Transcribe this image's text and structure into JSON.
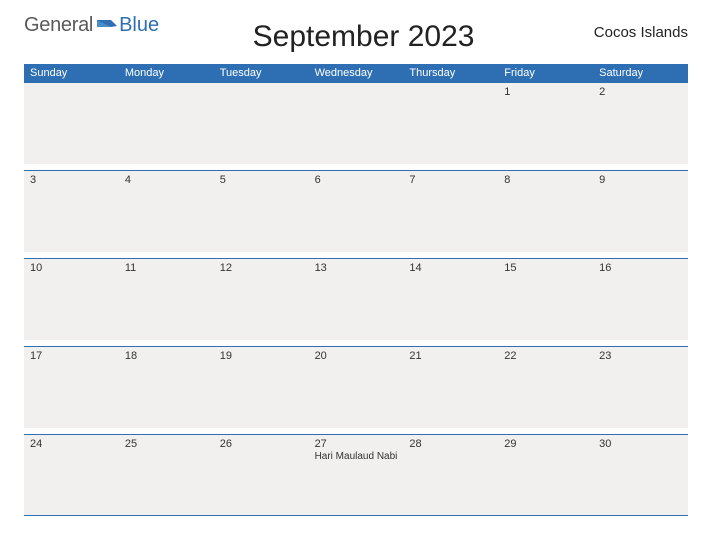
{
  "logo": {
    "general": "General",
    "blue": "Blue"
  },
  "title": "September 2023",
  "region": "Cocos Islands",
  "days": [
    "Sunday",
    "Monday",
    "Tuesday",
    "Wednesday",
    "Thursday",
    "Friday",
    "Saturday"
  ],
  "weeks": [
    [
      {
        "num": ""
      },
      {
        "num": ""
      },
      {
        "num": ""
      },
      {
        "num": ""
      },
      {
        "num": ""
      },
      {
        "num": "1"
      },
      {
        "num": "2"
      }
    ],
    [
      {
        "num": "3"
      },
      {
        "num": "4"
      },
      {
        "num": "5"
      },
      {
        "num": "6"
      },
      {
        "num": "7"
      },
      {
        "num": "8"
      },
      {
        "num": "9"
      }
    ],
    [
      {
        "num": "10"
      },
      {
        "num": "11"
      },
      {
        "num": "12"
      },
      {
        "num": "13"
      },
      {
        "num": "14"
      },
      {
        "num": "15"
      },
      {
        "num": "16"
      }
    ],
    [
      {
        "num": "17"
      },
      {
        "num": "18"
      },
      {
        "num": "19"
      },
      {
        "num": "20"
      },
      {
        "num": "21"
      },
      {
        "num": "22"
      },
      {
        "num": "23"
      }
    ],
    [
      {
        "num": "24"
      },
      {
        "num": "25"
      },
      {
        "num": "26"
      },
      {
        "num": "27",
        "event": "Hari Maulaud Nabi"
      },
      {
        "num": "28"
      },
      {
        "num": "29"
      },
      {
        "num": "30"
      }
    ]
  ]
}
